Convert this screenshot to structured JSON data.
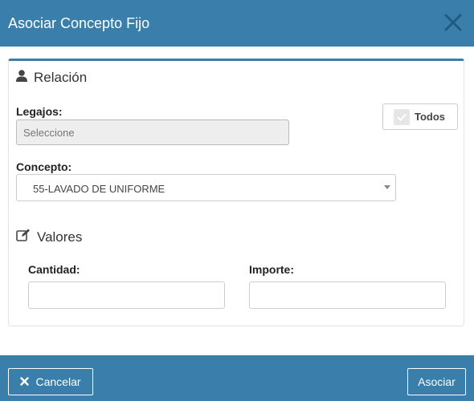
{
  "header": {
    "title": "Asociar Concepto Fijo"
  },
  "relacion": {
    "heading": "Relación",
    "legajos_label": "Legajos:",
    "legajos_placeholder": "Seleccione",
    "todos_label": "Todos",
    "concepto_label": "Concepto:",
    "concepto_value": "55-LAVADO DE UNIFORME"
  },
  "valores": {
    "heading": "Valores",
    "cantidad_label": "Cantidad:",
    "importe_label": "Importe:"
  },
  "footer": {
    "cancel_label": "Cancelar",
    "submit_label": "Asociar"
  },
  "colors": {
    "primary": "#3a7fab"
  },
  "icons": {
    "close": "close-icon",
    "user": "user-icon",
    "edit": "edit-icon",
    "check": "check-icon",
    "cancel": "cancel-x-icon"
  }
}
